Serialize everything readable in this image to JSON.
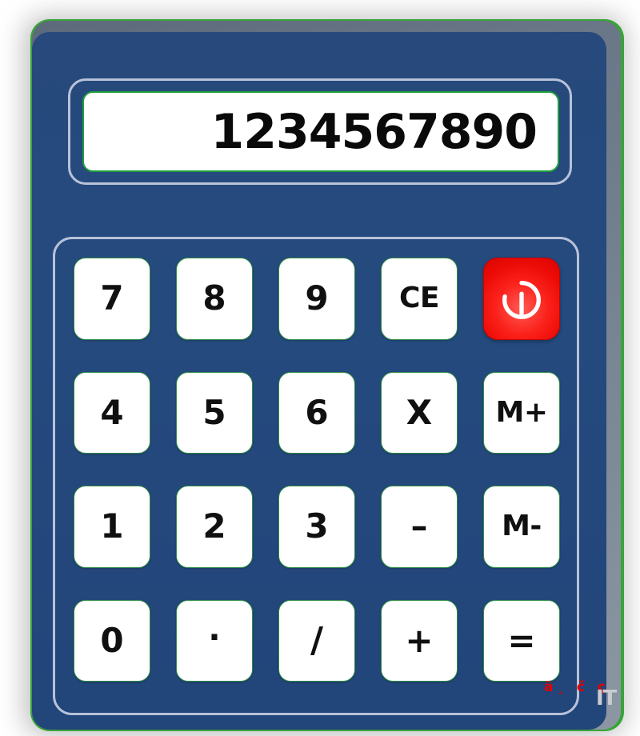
{
  "device": {
    "kind": "calculator",
    "body_color": "#254a7e",
    "rim_color": "#3aa33a",
    "bevel_color": "#6f7c8c",
    "panel_border_color": "#b8c2d8"
  },
  "display": {
    "value": "1234567890",
    "align": "right",
    "background": "#ffffff",
    "text_color": "#0a0a0a",
    "border_color": "#1e9e3a"
  },
  "keypad": {
    "columns": 5,
    "rows": 4,
    "key_background": "#ffffff",
    "key_border_color": "#2f8f45",
    "key_text_color": "#101010",
    "keys": [
      {
        "label": "7",
        "name": "key-7",
        "type": "digit",
        "style": "normal"
      },
      {
        "label": "8",
        "name": "key-8",
        "type": "digit",
        "style": "normal"
      },
      {
        "label": "9",
        "name": "key-9",
        "type": "digit",
        "style": "normal"
      },
      {
        "label": "CE",
        "name": "key-clear",
        "type": "function",
        "style": "small"
      },
      {
        "label": "",
        "name": "key-power",
        "type": "power",
        "style": "power"
      },
      {
        "label": "4",
        "name": "key-4",
        "type": "digit",
        "style": "normal"
      },
      {
        "label": "5",
        "name": "key-5",
        "type": "digit",
        "style": "normal"
      },
      {
        "label": "6",
        "name": "key-6",
        "type": "digit",
        "style": "normal"
      },
      {
        "label": "X",
        "name": "key-multiply",
        "type": "operator",
        "style": "normal"
      },
      {
        "label": "M+",
        "name": "key-memory-add",
        "type": "memory",
        "style": "small"
      },
      {
        "label": "1",
        "name": "key-1",
        "type": "digit",
        "style": "normal"
      },
      {
        "label": "2",
        "name": "key-2",
        "type": "digit",
        "style": "normal"
      },
      {
        "label": "3",
        "name": "key-3",
        "type": "digit",
        "style": "normal"
      },
      {
        "label": "–",
        "name": "key-subtract",
        "type": "operator",
        "style": "normal"
      },
      {
        "label": "M-",
        "name": "key-memory-subtract",
        "type": "memory",
        "style": "small"
      },
      {
        "label": "0",
        "name": "key-0",
        "type": "digit",
        "style": "normal"
      },
      {
        "label": "·",
        "name": "key-decimal",
        "type": "decimal",
        "style": "dot"
      },
      {
        "label": "/",
        "name": "key-divide",
        "type": "operator",
        "style": "slash"
      },
      {
        "label": "+",
        "name": "key-add",
        "type": "operator",
        "style": "normal"
      },
      {
        "label": "=",
        "name": "key-equals",
        "type": "operator",
        "style": "normal"
      }
    ],
    "power_icon": "power-icon",
    "power_color": "#ec0b06"
  },
  "watermark": {
    "text": "ä¸ č ç",
    "logo": "IT",
    "text_color": "#e60000",
    "logo_color": "#c9ccd0"
  }
}
